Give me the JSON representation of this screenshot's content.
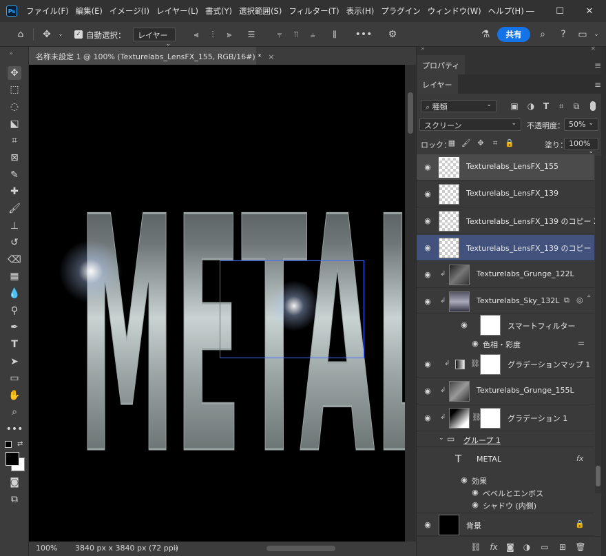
{
  "menubar": {
    "app_icon": "Ps",
    "items": [
      "ファイル(F)",
      "編集(E)",
      "イメージ(I)",
      "レイヤー(L)",
      "書式(Y)",
      "選択範囲(S)",
      "フィルター(T)",
      "表示(H)",
      "プラグイン",
      "ウィンドウ(W)",
      "ヘルプ(H)"
    ]
  },
  "window_controls": {
    "minimize": "—",
    "maximize": "☐",
    "close": "✕"
  },
  "options": {
    "auto_select_label": "自動選択：",
    "auto_select_target": "レイヤー",
    "share_label": "共有"
  },
  "document": {
    "tab_title": "名称未設定 1 @ 100% (Texturelabs_LensFX_155, RGB/16#) *",
    "close_glyph": "×",
    "canvas_text": "METAL",
    "zoom": "100%",
    "doc_info": "3840 px x 3840 px (72 ppi)",
    "status_arrow": "›"
  },
  "properties_panel": {
    "tab": "プロパティ"
  },
  "layers_panel": {
    "tab": "レイヤー",
    "filter_kind": "種類",
    "blend_mode": "スクリーン",
    "opacity_label": "不透明度：",
    "opacity_value": "50%",
    "lock_label": "ロック：",
    "fill_label": "塗り：",
    "fill_value": "100%",
    "layers": [
      {
        "name": "Texturelabs_LensFX_155"
      },
      {
        "name": "Texturelabs_LensFX_139"
      },
      {
        "name": "Texturelabs_LensFX_139 のコピー 2"
      },
      {
        "name": "Texturelabs_LensFX_139 のコピー"
      },
      {
        "name": "Texturelabs_Grunge_122L"
      },
      {
        "name": "Texturelabs_Sky_132L"
      },
      {
        "name": "グラデーションマップ 1"
      },
      {
        "name": "Texturelabs_Grunge_155L"
      },
      {
        "name": "グラデーション 1"
      },
      {
        "name": "グループ 1"
      },
      {
        "name": "METAL"
      },
      {
        "name": "背景"
      }
    ],
    "smart_filter_label": "スマートフィルター",
    "hue_sat_label": "色相・彩度",
    "effects_label": "効果",
    "bevel_label": "ベベルとエンボス",
    "inner_shadow_label": "シャドウ (内側)",
    "fx_label": "fx",
    "bottom_fx": "fx"
  },
  "colors": {
    "accent": "#1473e6",
    "selection_highlight": "#43517d"
  }
}
